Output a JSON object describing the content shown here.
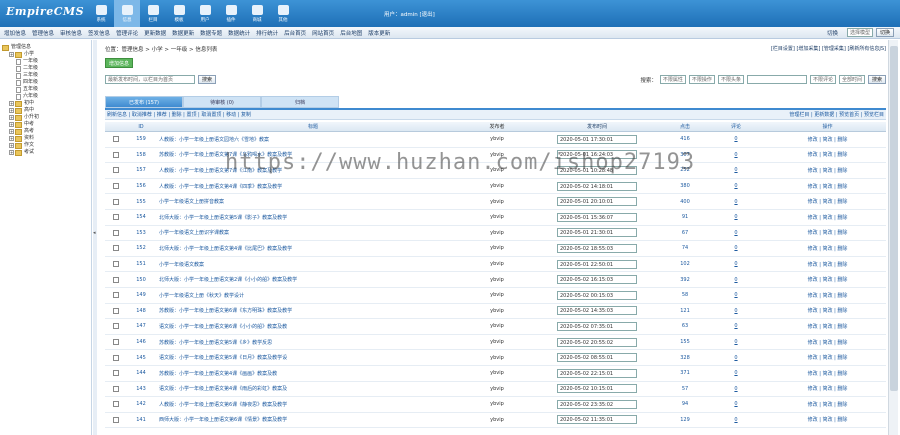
{
  "app": {
    "logo": "EmpireCMS"
  },
  "iconbar": [
    {
      "label": "系统",
      "icon": "system-icon"
    },
    {
      "label": "信息",
      "icon": "info-icon",
      "active": true
    },
    {
      "label": "栏目",
      "icon": "column-icon"
    },
    {
      "label": "模板",
      "icon": "template-icon"
    },
    {
      "label": "用户",
      "icon": "user-icon"
    },
    {
      "label": "插件",
      "icon": "plugin-icon"
    },
    {
      "label": "商城",
      "icon": "shop-icon"
    },
    {
      "label": "其他",
      "icon": "gear-icon"
    }
  ],
  "user": {
    "text": "用户：admin [退出]"
  },
  "menubar": [
    "增加信息",
    "管理信息",
    "审核信息",
    "签发信息",
    "管理评论",
    "更新数据",
    "数据更新",
    "数据专题",
    "数据统计",
    "排行统计",
    "后台首页",
    "网站首页",
    "后台地图",
    "版本更新"
  ],
  "menubar_right": {
    "label": "切换",
    "select": "选择模型",
    "button": "切换"
  },
  "tree": [
    {
      "label": "管理信息",
      "type": "root"
    },
    {
      "label": "小学",
      "type": "folder",
      "indent": 1
    },
    {
      "label": "一年级",
      "type": "doc",
      "indent": 2
    },
    {
      "label": "二年级",
      "type": "doc",
      "indent": 2
    },
    {
      "label": "三年级",
      "type": "doc",
      "indent": 2
    },
    {
      "label": "四年级",
      "type": "doc",
      "indent": 2
    },
    {
      "label": "五年级",
      "type": "doc",
      "indent": 2
    },
    {
      "label": "六年级",
      "type": "doc",
      "indent": 2
    },
    {
      "label": "初中",
      "type": "folder",
      "indent": 1
    },
    {
      "label": "高中",
      "type": "folder",
      "indent": 1
    },
    {
      "label": "小升初",
      "type": "folder",
      "indent": 1
    },
    {
      "label": "中考",
      "type": "folder",
      "indent": 1
    },
    {
      "label": "高考",
      "type": "folder",
      "indent": 1
    },
    {
      "label": "资料",
      "type": "folder",
      "indent": 1
    },
    {
      "label": "作文",
      "type": "folder",
      "indent": 1
    },
    {
      "label": "考试",
      "type": "folder",
      "indent": 1
    }
  ],
  "crumb": "位置：管理信息 > 小学 > 一年级 > 信息列表",
  "toplinks": "[栏目设置] [增加采集] [管理采集] [刷新所有信息JS]",
  "green_button": "增加信息",
  "sort": {
    "select": "最新发布时间，以栏目为首页",
    "button": "搜索"
  },
  "filters": {
    "label": "搜索：",
    "f1": "不限属性",
    "f2": "不限操作",
    "f3": "不限头条",
    "f4": "不限评论",
    "f5": "全部时间",
    "button": "搜索"
  },
  "tabs": [
    {
      "label": "已发布 (157)",
      "active": true
    },
    {
      "label": "待审核 (0)"
    },
    {
      "label": "归档"
    }
  ],
  "subbar": {
    "left": "刷新信息 | 取消推荐 | 推荐 | 删除 | 置顶 | 取消置顶 | 移动 | 复制",
    "right": "管理栏目 | 更新数据 | 预览首页 | 预览栏目"
  },
  "grid": {
    "headers": {
      "id": "ID",
      "title": "标题",
      "pub": "发布者",
      "time": "发布时间",
      "clicks": "点击",
      "cmt": "评论",
      "ops": "操作"
    },
    "rows": [
      {
        "id": "159",
        "title": "人教版：小学一年级上册语文园地六《雪地》教案",
        "pub": "ybvip",
        "time": "2020-05-01 17:30:01",
        "clicks": "416",
        "cmt": "0",
        "ops": "修改 | 简改 | 删除"
      },
      {
        "id": "158",
        "title": "苏教版：小学一年级上册语文第7课《乌鸦喝水》教案及教学",
        "pub": "ybvip",
        "time": "2020-05-01 16:24:03",
        "clicks": "307",
        "cmt": "0",
        "ops": "修改 | 简改 | 删除"
      },
      {
        "id": "157",
        "title": "人教版：小学一年级上册语文第7课《江南》教案及教学",
        "pub": "ybvip",
        "time": "2020-05-01 10:28:48",
        "clicks": "252",
        "cmt": "0",
        "ops": "修改 | 简改 | 删除"
      },
      {
        "id": "156",
        "title": "人教版：小学一年级上册语文第4课《四季》教案及教学",
        "pub": "ybvip",
        "time": "2020-05-02 14:18:01",
        "clicks": "380",
        "cmt": "0",
        "ops": "修改 | 简改 | 删除"
      },
      {
        "id": "155",
        "title": "小学一年级语文上册拼音教案",
        "pub": "ybvip",
        "time": "2020-05-01 20:10:01",
        "clicks": "400",
        "cmt": "0",
        "ops": "修改 | 简改 | 删除"
      },
      {
        "id": "154",
        "title": "北师大版：小学一年级上册语文第5课《影子》教案及教学",
        "pub": "ybvip",
        "time": "2020-05-01 15:36:07",
        "clicks": "91",
        "cmt": "0",
        "ops": "修改 | 简改 | 删除"
      },
      {
        "id": "153",
        "title": "小学一年级语文上册识字课教案",
        "pub": "ybvip",
        "time": "2020-05-01 21:30:01",
        "clicks": "67",
        "cmt": "0",
        "ops": "修改 | 简改 | 删除"
      },
      {
        "id": "152",
        "title": "北师大版：小学一年级上册语文第4课《比尾巴》教案及教学",
        "pub": "ybvip",
        "time": "2020-05-02 18:55:03",
        "clicks": "74",
        "cmt": "0",
        "ops": "修改 | 简改 | 删除"
      },
      {
        "id": "151",
        "title": "小学一年级语文教案",
        "pub": "ybvip",
        "time": "2020-05-01 22:50:01",
        "clicks": "102",
        "cmt": "0",
        "ops": "修改 | 简改 | 删除"
      },
      {
        "id": "150",
        "title": "北师大版：小学一年级上册语文第2课《小小的船》教案及教学",
        "pub": "ybvip",
        "time": "2020-05-02 16:15:03",
        "clicks": "392",
        "cmt": "0",
        "ops": "修改 | 简改 | 删除"
      },
      {
        "id": "149",
        "title": "小学一年级语文上册《秋天》教学设计",
        "pub": "ybvip",
        "time": "2020-05-02 00:15:03",
        "clicks": "58",
        "cmt": "0",
        "ops": "修改 | 简改 | 删除"
      },
      {
        "id": "148",
        "title": "苏教版：小学一年级上册语文第6课《东方明珠》教案及教学",
        "pub": "ybvip",
        "time": "2020-05-02 14:35:03",
        "clicks": "121",
        "cmt": "0",
        "ops": "修改 | 简改 | 删除"
      },
      {
        "id": "147",
        "title": "语文版：小学一年级上册语文第6课《小小的船》教案及教",
        "pub": "ybvip",
        "time": "2020-05-02 07:35:01",
        "clicks": "63",
        "cmt": "0",
        "ops": "修改 | 简改 | 删除"
      },
      {
        "id": "146",
        "title": "苏教版：小学一年级上册语文第5课《乡》教学反思",
        "pub": "ybvip",
        "time": "2020-05-02 20:55:02",
        "clicks": "155",
        "cmt": "0",
        "ops": "修改 | 简改 | 删除"
      },
      {
        "id": "145",
        "title": "语文版：小学一年级上册语文第5课《日月》教案及教学设",
        "pub": "ybvip",
        "time": "2020-05-02 08:55:01",
        "clicks": "328",
        "cmt": "0",
        "ops": "修改 | 简改 | 删除"
      },
      {
        "id": "144",
        "title": "苏教版：小学一年级上册语文第4课《画画》教案及教",
        "pub": "ybvip",
        "time": "2020-05-02 22:15:01",
        "clicks": "371",
        "cmt": "0",
        "ops": "修改 | 简改 | 删除"
      },
      {
        "id": "143",
        "title": "语文版：小学一年级上册语文第4课《雨后的彩虹》教案及",
        "pub": "ybvip",
        "time": "2020-05-02 10:15:01",
        "clicks": "57",
        "cmt": "0",
        "ops": "修改 | 简改 | 删除"
      },
      {
        "id": "142",
        "title": "人教版：小学一年级上册语文第6课《静夜思》教案及教学",
        "pub": "ybvip",
        "time": "2020-05-02 23:35:02",
        "clicks": "94",
        "cmt": "0",
        "ops": "修改 | 简改 | 删除"
      },
      {
        "id": "141",
        "title": "西师大版：小学一年级上册语文第6课《情景》教案及教学",
        "pub": "ybvip",
        "time": "2020-05-02 11:35:01",
        "clicks": "129",
        "cmt": "0",
        "ops": "修改 | 简改 | 删除"
      }
    ]
  },
  "watermark": "https://www.huzhan.com/ishop27193"
}
